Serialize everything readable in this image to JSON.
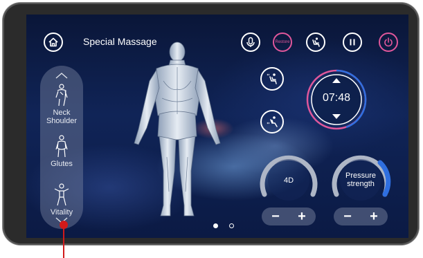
{
  "header": {
    "title": "Special Massage"
  },
  "top_buttons": {
    "restore_label": "Restore"
  },
  "sidebar": {
    "items": [
      {
        "label": "Neck\nShoulder"
      },
      {
        "label": "Glutes"
      },
      {
        "label": "Vitality"
      }
    ]
  },
  "timer": {
    "value": "07:48"
  },
  "gauges": {
    "mode": {
      "label": "4D",
      "level": 0.5
    },
    "pressure": {
      "label": "Pressure\nstrength",
      "level": 0.7
    }
  },
  "steppers": {
    "minus": "−",
    "plus": "+"
  },
  "pagination": {
    "current": 1,
    "total": 2
  },
  "colors": {
    "accent_pink": "#e0579b",
    "accent_blue": "#2f6fe0",
    "pointer_red": "#d11a1a"
  }
}
